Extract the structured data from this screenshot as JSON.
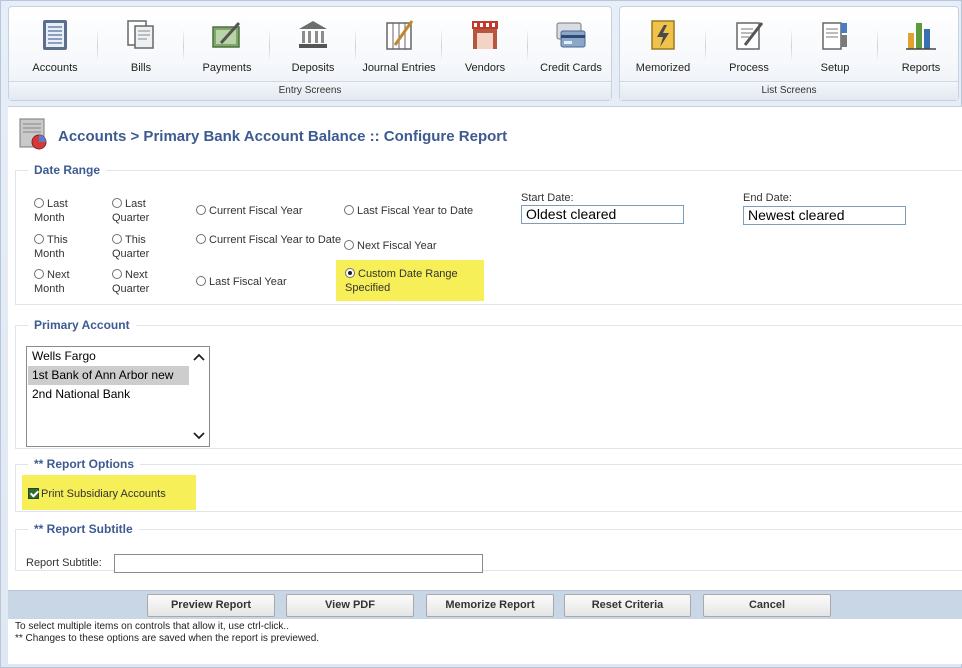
{
  "toolbar": {
    "entry_screens": {
      "caption": "Entry Screens",
      "items": [
        {
          "label": "Accounts",
          "icon": "ledger-icon"
        },
        {
          "label": "Bills",
          "icon": "bills-icon"
        },
        {
          "label": "Payments",
          "icon": "payments-icon"
        },
        {
          "label": "Deposits",
          "icon": "bank-icon"
        },
        {
          "label": "Journal Entries",
          "icon": "journal-icon"
        },
        {
          "label": "Vendors",
          "icon": "storefront-icon"
        },
        {
          "label": "Credit Cards",
          "icon": "credit-card-icon"
        }
      ]
    },
    "list_screens": {
      "caption": "List Screens",
      "items": [
        {
          "label": "Memorized",
          "icon": "memorized-icon"
        },
        {
          "label": "Process",
          "icon": "process-icon"
        },
        {
          "label": "Setup",
          "icon": "setup-icon"
        },
        {
          "label": "Reports",
          "icon": "bar-chart-icon"
        }
      ]
    }
  },
  "page": {
    "title": "Accounts > Primary Bank Account Balance :: Configure Report"
  },
  "date_range": {
    "legend": "Date Range",
    "options": {
      "last_month": "Last Month",
      "last_quarter": "Last Quarter",
      "current_fiscal_year": "Current Fiscal Year",
      "last_fiscal_year_to_date": "Last Fiscal Year to Date",
      "this_month": "This Month",
      "this_quarter": "This Quarter",
      "current_fiscal_year_to_date": "Current Fiscal Year to Date",
      "next_fiscal_year": "Next Fiscal Year",
      "next_month": "Next Month",
      "next_quarter": "Next Quarter",
      "last_fiscal_year": "Last Fiscal Year",
      "custom_date_range": "Custom Date Range Specified"
    },
    "selected": "custom_date_range",
    "start_date_label": "Start Date:",
    "start_date_value": "Oldest cleared",
    "end_date_label": "End Date:",
    "end_date_value": "Newest cleared"
  },
  "primary_account": {
    "legend": "Primary Account",
    "options": [
      "Wells Fargo",
      "1st Bank of Ann Arbor new",
      "2nd National Bank"
    ],
    "selected_index": 1
  },
  "report_options": {
    "legend": "** Report Options",
    "print_subsidiary_label": "Print Subsidiary Accounts",
    "print_subsidiary_checked": true
  },
  "report_subtitle": {
    "legend": "** Report Subtitle",
    "label": "Report Subtitle:",
    "value": ""
  },
  "buttons": {
    "preview": "Preview Report",
    "view_pdf": "View PDF",
    "memorize": "Memorize Report",
    "reset": "Reset Criteria",
    "cancel": "Cancel"
  },
  "footnotes": {
    "line1": "To select multiple items on controls that allow it, use ctrl-click..",
    "line2": "** Changes to these options are saved when the report is previewed."
  },
  "colors": {
    "title": "#3d5a91",
    "highlight": "#f6ef57",
    "button_bar": "#c9d6e6"
  }
}
